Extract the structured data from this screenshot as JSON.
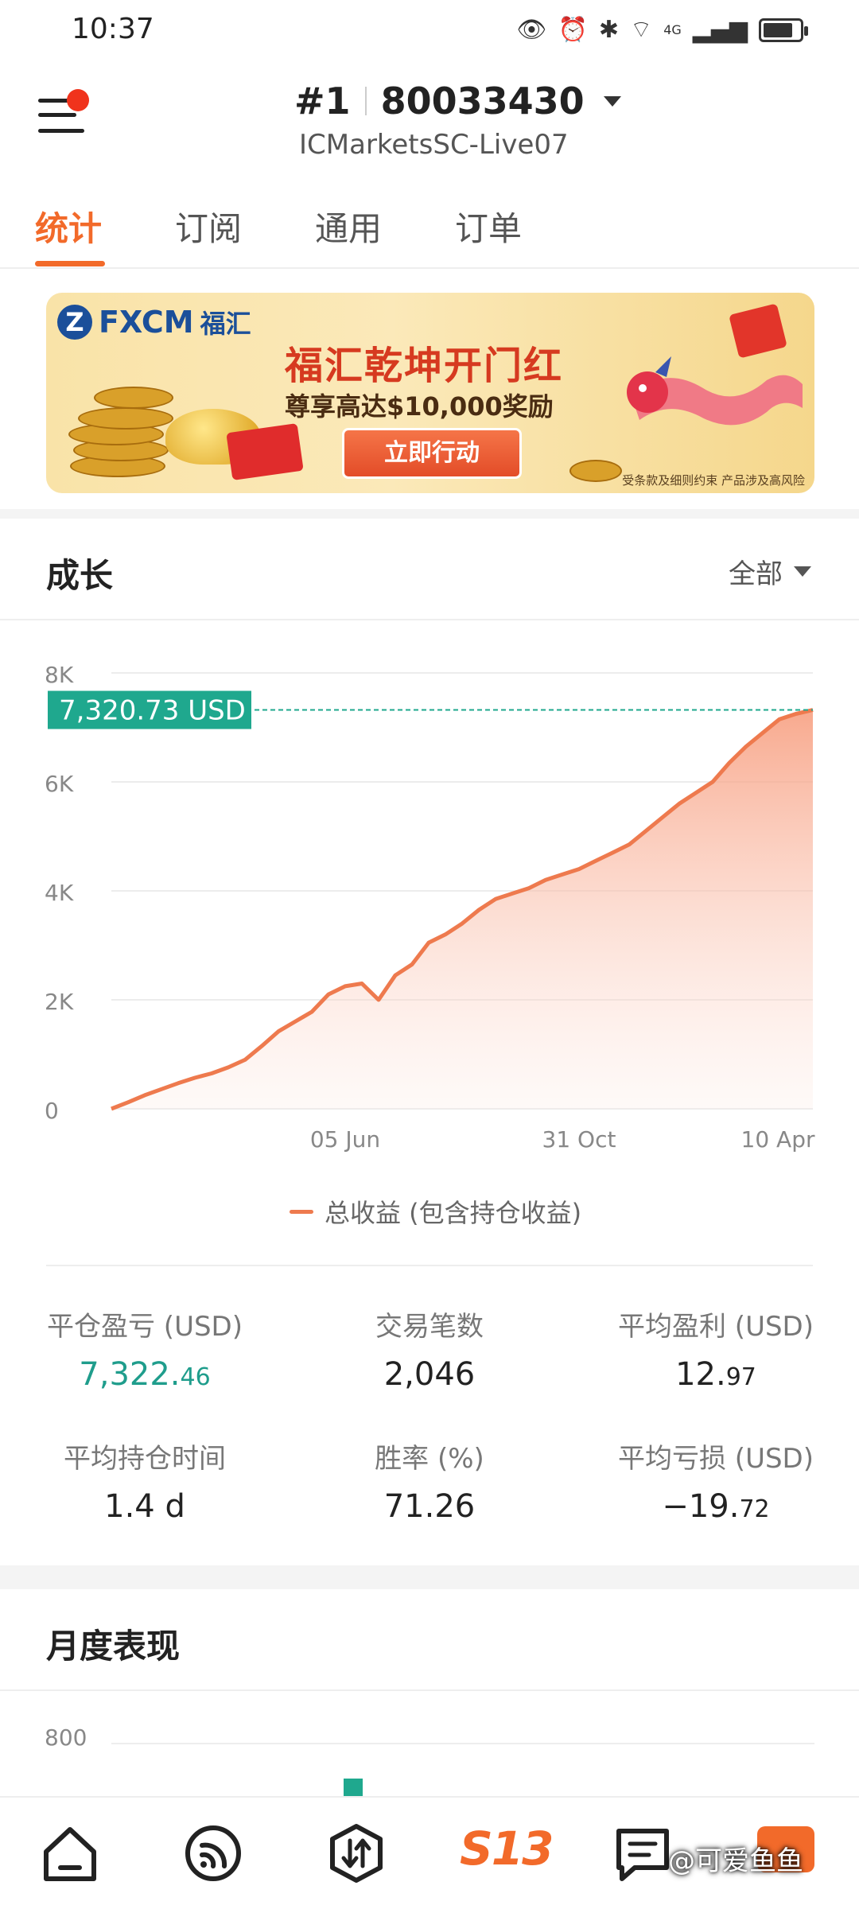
{
  "status_bar": {
    "time": "10:37",
    "network": "4G"
  },
  "header": {
    "rank": "#1",
    "account_number": "80033430",
    "server": "ICMarketsSC-Live07"
  },
  "tabs": [
    {
      "label": "统计",
      "active": true
    },
    {
      "label": "订阅",
      "active": false
    },
    {
      "label": "通用",
      "active": false
    },
    {
      "label": "订单",
      "active": false
    }
  ],
  "banner": {
    "brand": "FXCM",
    "brand_cn": "福汇",
    "headline": "福汇乾坤开门红",
    "subline": "尊享高达$10,000奖励",
    "cta": "立即行动",
    "disclaimer": "受条款及细则约束  产品涉及高风险"
  },
  "growth": {
    "title": "成长",
    "range": "全部",
    "legend": "总收益 (包含持仓收益)",
    "current_label": "7,320.73 USD",
    "colors": {
      "line": "#ee7a4e",
      "marker": "#1fa88e"
    }
  },
  "chart_data": {
    "type": "area",
    "y_ticks": [
      "8K",
      "6K",
      "4K",
      "2K",
      "0"
    ],
    "x_ticks": [
      "05 Jun",
      "31 Oct",
      "10 Apr"
    ],
    "ylim": [
      0,
      8000
    ],
    "current_value": 7320.73,
    "series": [
      {
        "name": "总收益 (包含持仓收益)",
        "values": [
          0,
          120,
          250,
          360,
          470,
          570,
          650,
          760,
          900,
          1150,
          1420,
          1600,
          1780,
          2100,
          2250,
          2300,
          2000,
          2450,
          2650,
          3050,
          3200,
          3400,
          3650,
          3850,
          3950,
          4050,
          4200,
          4300,
          4400,
          4550,
          4700,
          4850,
          5100,
          5350,
          5600,
          5800,
          6000,
          6350,
          6650,
          6900,
          7150,
          7250,
          7320.73
        ]
      }
    ]
  },
  "stats": [
    {
      "label": "平仓盈亏 (USD)",
      "main": "7,322.",
      "frac": "46",
      "green": true
    },
    {
      "label": "交易笔数",
      "main": "2,046",
      "frac": "",
      "green": false
    },
    {
      "label": "平均盈利 (USD)",
      "main": "12.",
      "frac": "97",
      "green": false
    },
    {
      "label": "平均持仓时间",
      "main": "1.4 d",
      "frac": "",
      "green": false
    },
    {
      "label": "胜率 (%)",
      "main": "71.26",
      "frac": "",
      "green": false
    },
    {
      "label": "平均亏损 (USD)",
      "main": "−19.",
      "frac": "72",
      "green": false
    }
  ],
  "monthly": {
    "title": "月度表现",
    "y_top": "800"
  },
  "nav": {
    "s13": "S13"
  },
  "watermark": "@可爱鱼鱼"
}
